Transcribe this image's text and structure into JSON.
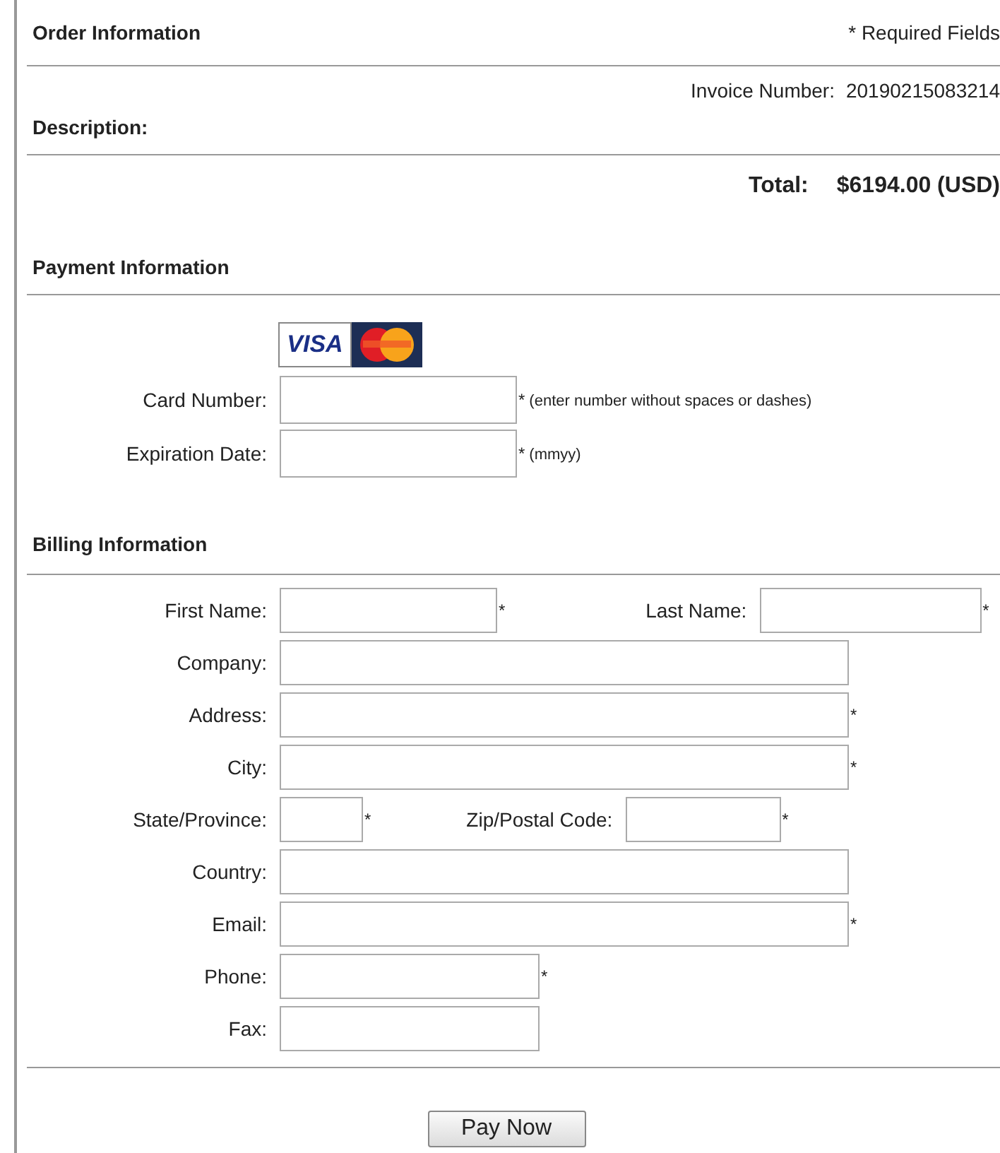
{
  "order": {
    "title": "Order Information",
    "required_note": "* Required Fields",
    "invoice_label": "Invoice Number:",
    "invoice_number": "20190215083214",
    "description_label": "Description:",
    "total_label": "Total:",
    "total_value": "$6194.00 (USD)"
  },
  "payment": {
    "title": "Payment Information",
    "card_logos": [
      {
        "kind": "visa",
        "text": "VISA"
      },
      {
        "kind": "mastercard"
      }
    ],
    "rows": [
      {
        "fields": [
          {
            "label": "Card Number:",
            "kind": "medium",
            "marker": "*",
            "hint": "(enter number without spaces or dashes)"
          }
        ]
      },
      {
        "fields": [
          {
            "label": "Expiration Date:",
            "kind": "medium",
            "marker": "*",
            "hint": "(mmyy)"
          }
        ]
      }
    ]
  },
  "billing": {
    "title": "Billing Information",
    "rows": [
      {
        "fields": [
          {
            "label": "First Name:",
            "kind": "half",
            "marker": "*"
          },
          {
            "label": "Last Name:",
            "kind": "half2",
            "marker": "*"
          }
        ]
      },
      {
        "fields": [
          {
            "label": "Company:",
            "kind": "wide"
          }
        ]
      },
      {
        "fields": [
          {
            "label": "Address:",
            "kind": "wide",
            "marker": "*"
          }
        ]
      },
      {
        "fields": [
          {
            "label": "City:",
            "kind": "wide",
            "marker": "*"
          }
        ]
      },
      {
        "fields": [
          {
            "label": "State/Province:",
            "kind": "tiny",
            "marker": "*"
          },
          {
            "label": "Zip/Postal Code:",
            "kind": "zip",
            "marker": "*"
          }
        ]
      },
      {
        "fields": [
          {
            "label": "Country:",
            "kind": "wide"
          }
        ]
      },
      {
        "fields": [
          {
            "label": "Email:",
            "kind": "wide",
            "marker": "*"
          }
        ]
      },
      {
        "fields": [
          {
            "label": "Phone:",
            "kind": "short",
            "marker": "*"
          }
        ]
      },
      {
        "fields": [
          {
            "label": "Fax:",
            "kind": "short"
          }
        ]
      }
    ]
  },
  "submit": {
    "label": "Pay Now"
  }
}
